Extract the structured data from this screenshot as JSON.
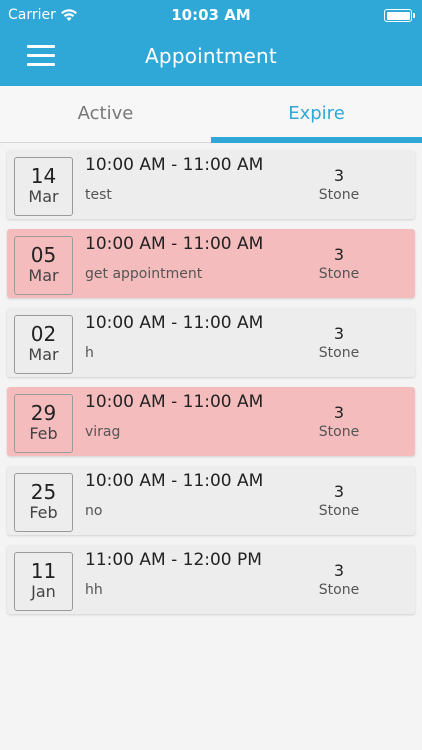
{
  "status_bar": {
    "carrier": "Carrier",
    "time": "10:03 AM"
  },
  "header": {
    "title": "Appointment"
  },
  "tabs": [
    {
      "label": "Active",
      "selected": false
    },
    {
      "label": "Expire",
      "selected": true
    }
  ],
  "colors": {
    "primary": "#2fa8d8",
    "expired_row": "#f4bcbd",
    "normal_row": "#eeeded"
  },
  "appointments": [
    {
      "day": "14",
      "month": "Mar",
      "time": "10:00 AM - 11:00 AM",
      "description": "test",
      "count": "3",
      "unit": "Stone",
      "highlighted": false
    },
    {
      "day": "05",
      "month": "Mar",
      "time": "10:00 AM - 11:00 AM",
      "description": "get appointment",
      "count": "3",
      "unit": "Stone",
      "highlighted": true
    },
    {
      "day": "02",
      "month": "Mar",
      "time": "10:00 AM - 11:00 AM",
      "description": "h",
      "count": "3",
      "unit": "Stone",
      "highlighted": false
    },
    {
      "day": "29",
      "month": "Feb",
      "time": "10:00 AM - 11:00 AM",
      "description": "virag",
      "count": "3",
      "unit": "Stone",
      "highlighted": true
    },
    {
      "day": "25",
      "month": "Feb",
      "time": "10:00 AM - 11:00 AM",
      "description": "no",
      "count": "3",
      "unit": "Stone",
      "highlighted": false
    },
    {
      "day": "11",
      "month": "Jan",
      "time": "11:00 AM - 12:00 PM",
      "description": "hh",
      "count": "3",
      "unit": "Stone",
      "highlighted": false
    }
  ]
}
